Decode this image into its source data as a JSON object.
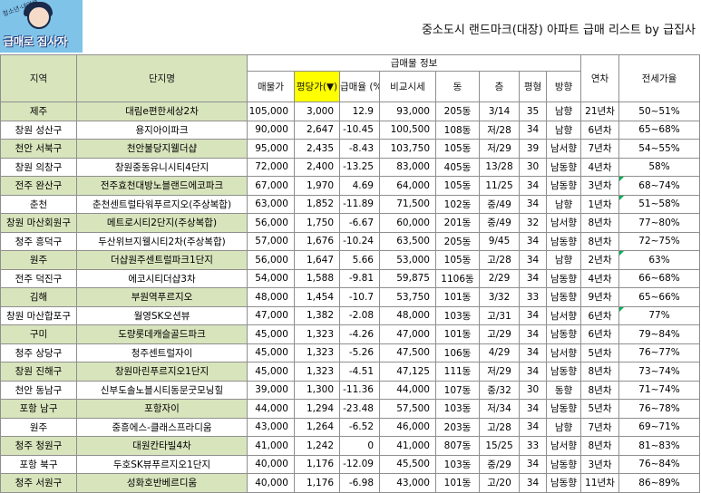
{
  "logo": {
    "tagline": "청소년·내인생",
    "brand": "급매로 집사자"
  },
  "title": "중소도시 랜드마크(대장) 아파트 급매 리스트 by 급집사",
  "headers": {
    "region": "지역",
    "complex": "단지명",
    "group": "급매물 정보",
    "price": "매물가",
    "per_pyeong": "평당가(▼)",
    "discount": "급매율 (%)",
    "compare": "비교시세",
    "building": "동",
    "floor": "층",
    "pyeong": "평형",
    "direction": "방향",
    "age": "연차",
    "jeonse": "전세가율"
  },
  "colors": {
    "highlight_row": "#d8e4bc",
    "sorted_header": "#ffff00",
    "logo_bg": "#7fc3e8"
  },
  "rows": [
    {
      "region": "제주",
      "name": "대림e편한세상2차",
      "price": "105,000",
      "pp": "3,000",
      "disc": "12.9",
      "cmp": "93,000",
      "bld": "205동",
      "floor": "3/14",
      "py": "35",
      "dir": "남향",
      "age": "21년차",
      "js": "50~51%"
    },
    {
      "region": "창원 성산구",
      "name": "용지아이파크",
      "price": "90,000",
      "pp": "2,647",
      "disc": "-10.45",
      "cmp": "100,500",
      "bld": "108동",
      "floor": "저/28",
      "py": "34",
      "dir": "남향",
      "age": "6년차",
      "js": "65~68%"
    },
    {
      "region": "천안 서북구",
      "name": "천안불당지웰더샵",
      "price": "95,000",
      "pp": "2,435",
      "disc": "-8.43",
      "cmp": "103,750",
      "bld": "105동",
      "floor": "저/29",
      "py": "39",
      "dir": "남서향",
      "age": "7년차",
      "js": "54~55%"
    },
    {
      "region": "창원 의창구",
      "name": "창원중동유니시티4단지",
      "price": "72,000",
      "pp": "2,400",
      "disc": "-13.25",
      "cmp": "83,000",
      "bld": "405동",
      "floor": "13/28",
      "py": "30",
      "dir": "남동향",
      "age": "4년차",
      "js": "58%"
    },
    {
      "region": "전주 완산구",
      "name": "전주효천대방노블랜드에코파크",
      "price": "67,000",
      "pp": "1,970",
      "disc": "4.69",
      "cmp": "64,000",
      "bld": "105동",
      "floor": "11/25",
      "py": "34",
      "dir": "남동향",
      "age": "3년차",
      "js": "68~74%"
    },
    {
      "region": "춘천",
      "name": "춘천센트럴타워푸르지오(주상복합)",
      "price": "63,000",
      "pp": "1,852",
      "disc": "-11.89",
      "cmp": "71,500",
      "bld": "102동",
      "floor": "중/49",
      "py": "34",
      "dir": "남향",
      "age": "1년차",
      "js": "51~58%"
    },
    {
      "region": "창원 마산회원구",
      "name": "메트로시티2단지(주상복합)",
      "price": "56,000",
      "pp": "1,750",
      "disc": "-6.67",
      "cmp": "60,000",
      "bld": "201동",
      "floor": "중/49",
      "py": "32",
      "dir": "남서향",
      "age": "8년차",
      "js": "77~80%"
    },
    {
      "region": "청주 흥덕구",
      "name": "두산위브지웰시티2차(주상복합)",
      "price": "57,000",
      "pp": "1,676",
      "disc": "-10.24",
      "cmp": "63,500",
      "bld": "205동",
      "floor": "9/45",
      "py": "34",
      "dir": "남동향",
      "age": "8년차",
      "js": "72~75%"
    },
    {
      "region": "원주",
      "name": "더샵원주센트럴파크1단지",
      "price": "56,000",
      "pp": "1,647",
      "disc": "5.66",
      "cmp": "53,000",
      "bld": "105동",
      "floor": "고/28",
      "py": "34",
      "dir": "남향",
      "age": "2년차",
      "js": "63%"
    },
    {
      "region": "전주 덕진구",
      "name": "에코시티더샵3차",
      "price": "54,000",
      "pp": "1,588",
      "disc": "-9.81",
      "cmp": "59,875",
      "bld": "1106동",
      "floor": "2/29",
      "py": "34",
      "dir": "남동향",
      "age": "4년차",
      "js": "66~68%"
    },
    {
      "region": "김해",
      "name": "부원역푸르지오",
      "price": "48,000",
      "pp": "1,454",
      "disc": "-10.7",
      "cmp": "53,750",
      "bld": "101동",
      "floor": "3/32",
      "py": "33",
      "dir": "남동향",
      "age": "9년차",
      "js": "65~66%"
    },
    {
      "region": "창원 마산합포구",
      "name": "월영SK오션뷰",
      "price": "47,000",
      "pp": "1,382",
      "disc": "-2.08",
      "cmp": "48,000",
      "bld": "103동",
      "floor": "고/31",
      "py": "34",
      "dir": "남서향",
      "age": "6년차",
      "js": "77%"
    },
    {
      "region": "구미",
      "name": "도량롯데캐슬골드파크",
      "price": "45,000",
      "pp": "1,323",
      "disc": "-4.26",
      "cmp": "47,000",
      "bld": "101동",
      "floor": "고/29",
      "py": "34",
      "dir": "남동향",
      "age": "6년차",
      "js": "79~84%"
    },
    {
      "region": "청주 상당구",
      "name": "청주센트럴자이",
      "price": "45,000",
      "pp": "1,323",
      "disc": "-5.26",
      "cmp": "47,500",
      "bld": "106동",
      "floor": "4/29",
      "py": "34",
      "dir": "남서향",
      "age": "5년차",
      "js": "76~77%"
    },
    {
      "region": "창원 진해구",
      "name": "창원마린푸르지오1단지",
      "price": "45,000",
      "pp": "1,323",
      "disc": "-4.51",
      "cmp": "47,125",
      "bld": "111동",
      "floor": "저/29",
      "py": "34",
      "dir": "남동향",
      "age": "8년차",
      "js": "73~74%"
    },
    {
      "region": "천안 동남구",
      "name": "신부도솔노블시티동문굿모닝힐",
      "price": "39,000",
      "pp": "1,300",
      "disc": "-11.36",
      "cmp": "44,000",
      "bld": "107동",
      "floor": "중/32",
      "py": "30",
      "dir": "동향",
      "age": "8년차",
      "js": "71~74%"
    },
    {
      "region": "포항 남구",
      "name": "포항자이",
      "price": "44,000",
      "pp": "1,294",
      "disc": "-23.48",
      "cmp": "57,500",
      "bld": "103동",
      "floor": "저/34",
      "py": "34",
      "dir": "남동향",
      "age": "5년차",
      "js": "76~78%"
    },
    {
      "region": "원주",
      "name": "중흥에스-클래스프라디움",
      "price": "43,000",
      "pp": "1,264",
      "disc": "-6.52",
      "cmp": "46,000",
      "bld": "203동",
      "floor": "고/28",
      "py": "34",
      "dir": "남향",
      "age": "7년차",
      "js": "69~71%"
    },
    {
      "region": "청주 청원구",
      "name": "대원칸타빌4차",
      "price": "41,000",
      "pp": "1,242",
      "disc": "0",
      "cmp": "41,000",
      "bld": "807동",
      "floor": "15/25",
      "py": "33",
      "dir": "남서향",
      "age": "8년차",
      "js": "81~83%"
    },
    {
      "region": "포항 북구",
      "name": "두호SK뷰푸르지오1단지",
      "price": "40,000",
      "pp": "1,176",
      "disc": "-12.09",
      "cmp": "45,500",
      "bld": "103동",
      "floor": "중/29",
      "py": "34",
      "dir": "남동향",
      "age": "3년차",
      "js": "76~84%"
    },
    {
      "region": "청주 서원구",
      "name": "성화호반베르디움",
      "price": "40,000",
      "pp": "1,176",
      "disc": "-6.98",
      "cmp": "43,000",
      "bld": "101동",
      "floor": "고/20",
      "py": "34",
      "dir": "남동향",
      "age": "11년차",
      "js": "86~89%"
    }
  ]
}
